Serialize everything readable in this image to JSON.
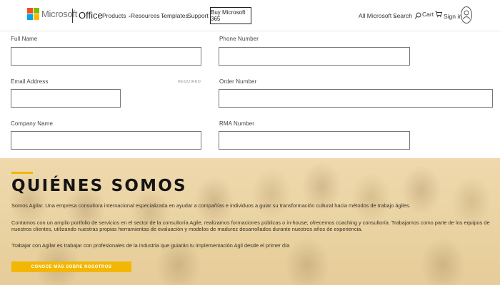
{
  "header": {
    "logo_text": "Microsoft",
    "brand_colors": [
      "#f25022",
      "#7fba00",
      "#00a4ef",
      "#ffb900"
    ],
    "product": "Office",
    "nav": [
      {
        "label": "Products",
        "dropdown": true
      },
      {
        "label": "Resources",
        "dropdown": true
      },
      {
        "label": "Templates",
        "dropdown": false
      },
      {
        "label": "Support",
        "dropdown": false
      }
    ],
    "buy_button": "Buy Microsoft 365",
    "all_microsoft": "All Microsoft",
    "search": "Search",
    "cart": "Cart",
    "signin": "Sign in"
  },
  "form": {
    "full_name": "Full Name",
    "phone_number": "Phone Number",
    "email_address": "Email Address",
    "required_tag": "REQUIRED",
    "order_number": "Order Number",
    "company_name": "Company Name",
    "rma_number": "RMA Number"
  },
  "about": {
    "title": "QUIÉNES SOMOS",
    "p1": "Somos Agilar. Una empresa consultora internacional especializada en ayudar a compañías e individuos a guiar su transformación cultural hacia métodos de trabajo ágiles.",
    "p2": "Contamos con un amplio portfolio de servicios en el sector de la consultoría Agile, realizamos formaciones públicas o in-house; ofrecemos coaching y consultoría. Trabajamos como parte de los equipos de nuestros clientes, utilizando nuestras propias herramientas de evaluación y modelos de madurez desarrollados durante nuestros años de experiencia.",
    "p3": "Trabajar con Agilar es trabajar con profesionales de la industria que guiarán tu implementación Agil desde el primer día",
    "cta": "CONOCE MÁS SOBRE NOSOTROS",
    "accent_color": "#f2b705"
  }
}
